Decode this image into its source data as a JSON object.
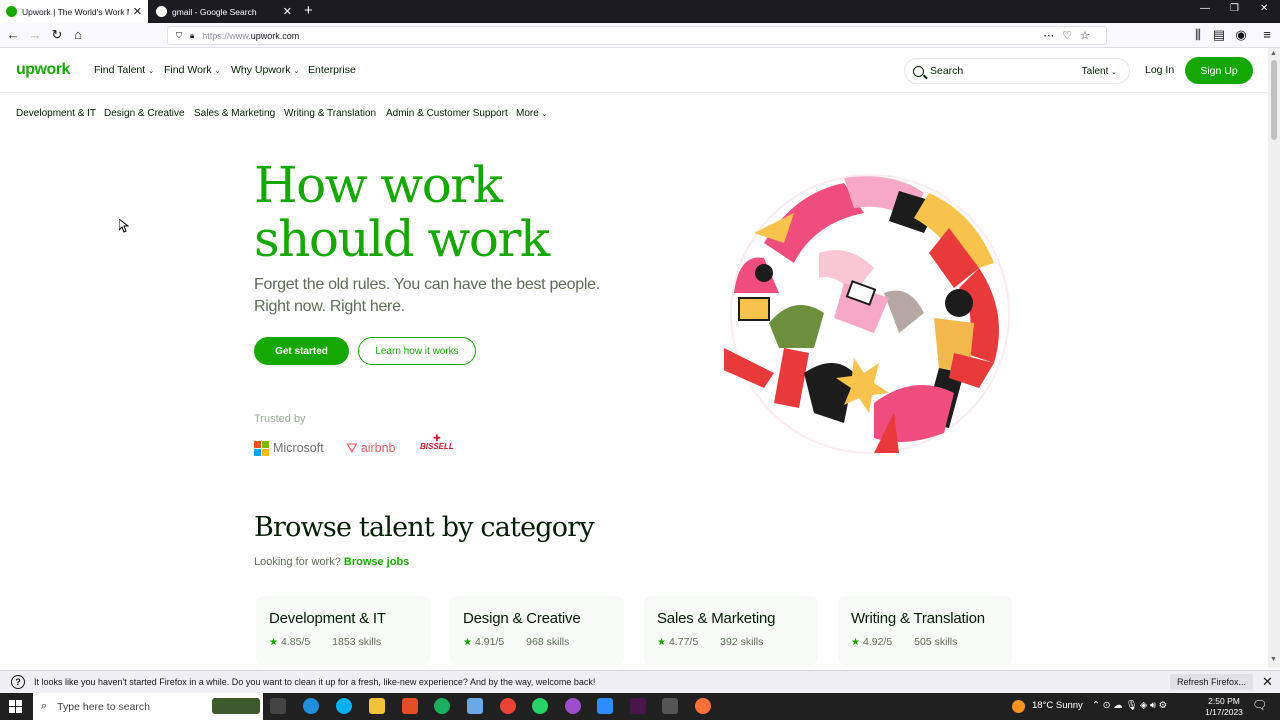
{
  "browser": {
    "tabs": [
      {
        "title": "Upwork | The World's Work Ma",
        "active": true
      },
      {
        "title": "gmail - Google Search",
        "active": false
      }
    ],
    "url_prefix": "https://www.",
    "url_host": "upwork.com"
  },
  "header": {
    "logo": "upwork",
    "nav": [
      {
        "label": "Find Talent",
        "dropdown": true
      },
      {
        "label": "Find Work",
        "dropdown": true
      },
      {
        "label": "Why Upwork",
        "dropdown": true
      },
      {
        "label": "Enterprise",
        "dropdown": false
      }
    ],
    "search_placeholder": "Search",
    "search_scope": "Talent",
    "login": "Log In",
    "signup": "Sign Up"
  },
  "categories_nav": [
    "Development & IT",
    "Design & Creative",
    "Sales & Marketing",
    "Writing & Translation",
    "Admin & Customer Support",
    "More"
  ],
  "hero": {
    "title_line1": "How work",
    "title_line2": "should work",
    "subtitle_line1": "Forget the old rules. You can have the best people.",
    "subtitle_line2": "Right now. Right here.",
    "cta_primary": "Get started",
    "cta_secondary": "Learn how it works",
    "trusted_label": "Trusted by",
    "brands": [
      "Microsoft",
      "airbnb",
      "BISSELL"
    ]
  },
  "browse": {
    "title": "Browse talent by category",
    "prompt": "Looking for work?",
    "link": "Browse jobs",
    "cards": [
      {
        "title": "Development & IT",
        "rating": "4.85/5",
        "skills": "1853 skills"
      },
      {
        "title": "Design & Creative",
        "rating": "4.91/5",
        "skills": "968 skills"
      },
      {
        "title": "Sales & Marketing",
        "rating": "4.77/5",
        "skills": "392 skills"
      },
      {
        "title": "Writing & Translation",
        "rating": "4.92/5",
        "skills": "505 skills"
      }
    ]
  },
  "notification": {
    "message": "It looks like you haven't started Firefox in a while. Do you want to clean it up for a fresh, like-new experience? And by the way, welcome back!",
    "button": "Refresh Firefox..."
  },
  "taskbar": {
    "search_placeholder": "Type here to search",
    "weather": "18°C  Sunny",
    "time": "2:50 PM",
    "date": "1/17/2023"
  },
  "colors": {
    "brand_green": "#14a800",
    "text_dark": "#001e00",
    "text_muted": "#5e6d55"
  }
}
